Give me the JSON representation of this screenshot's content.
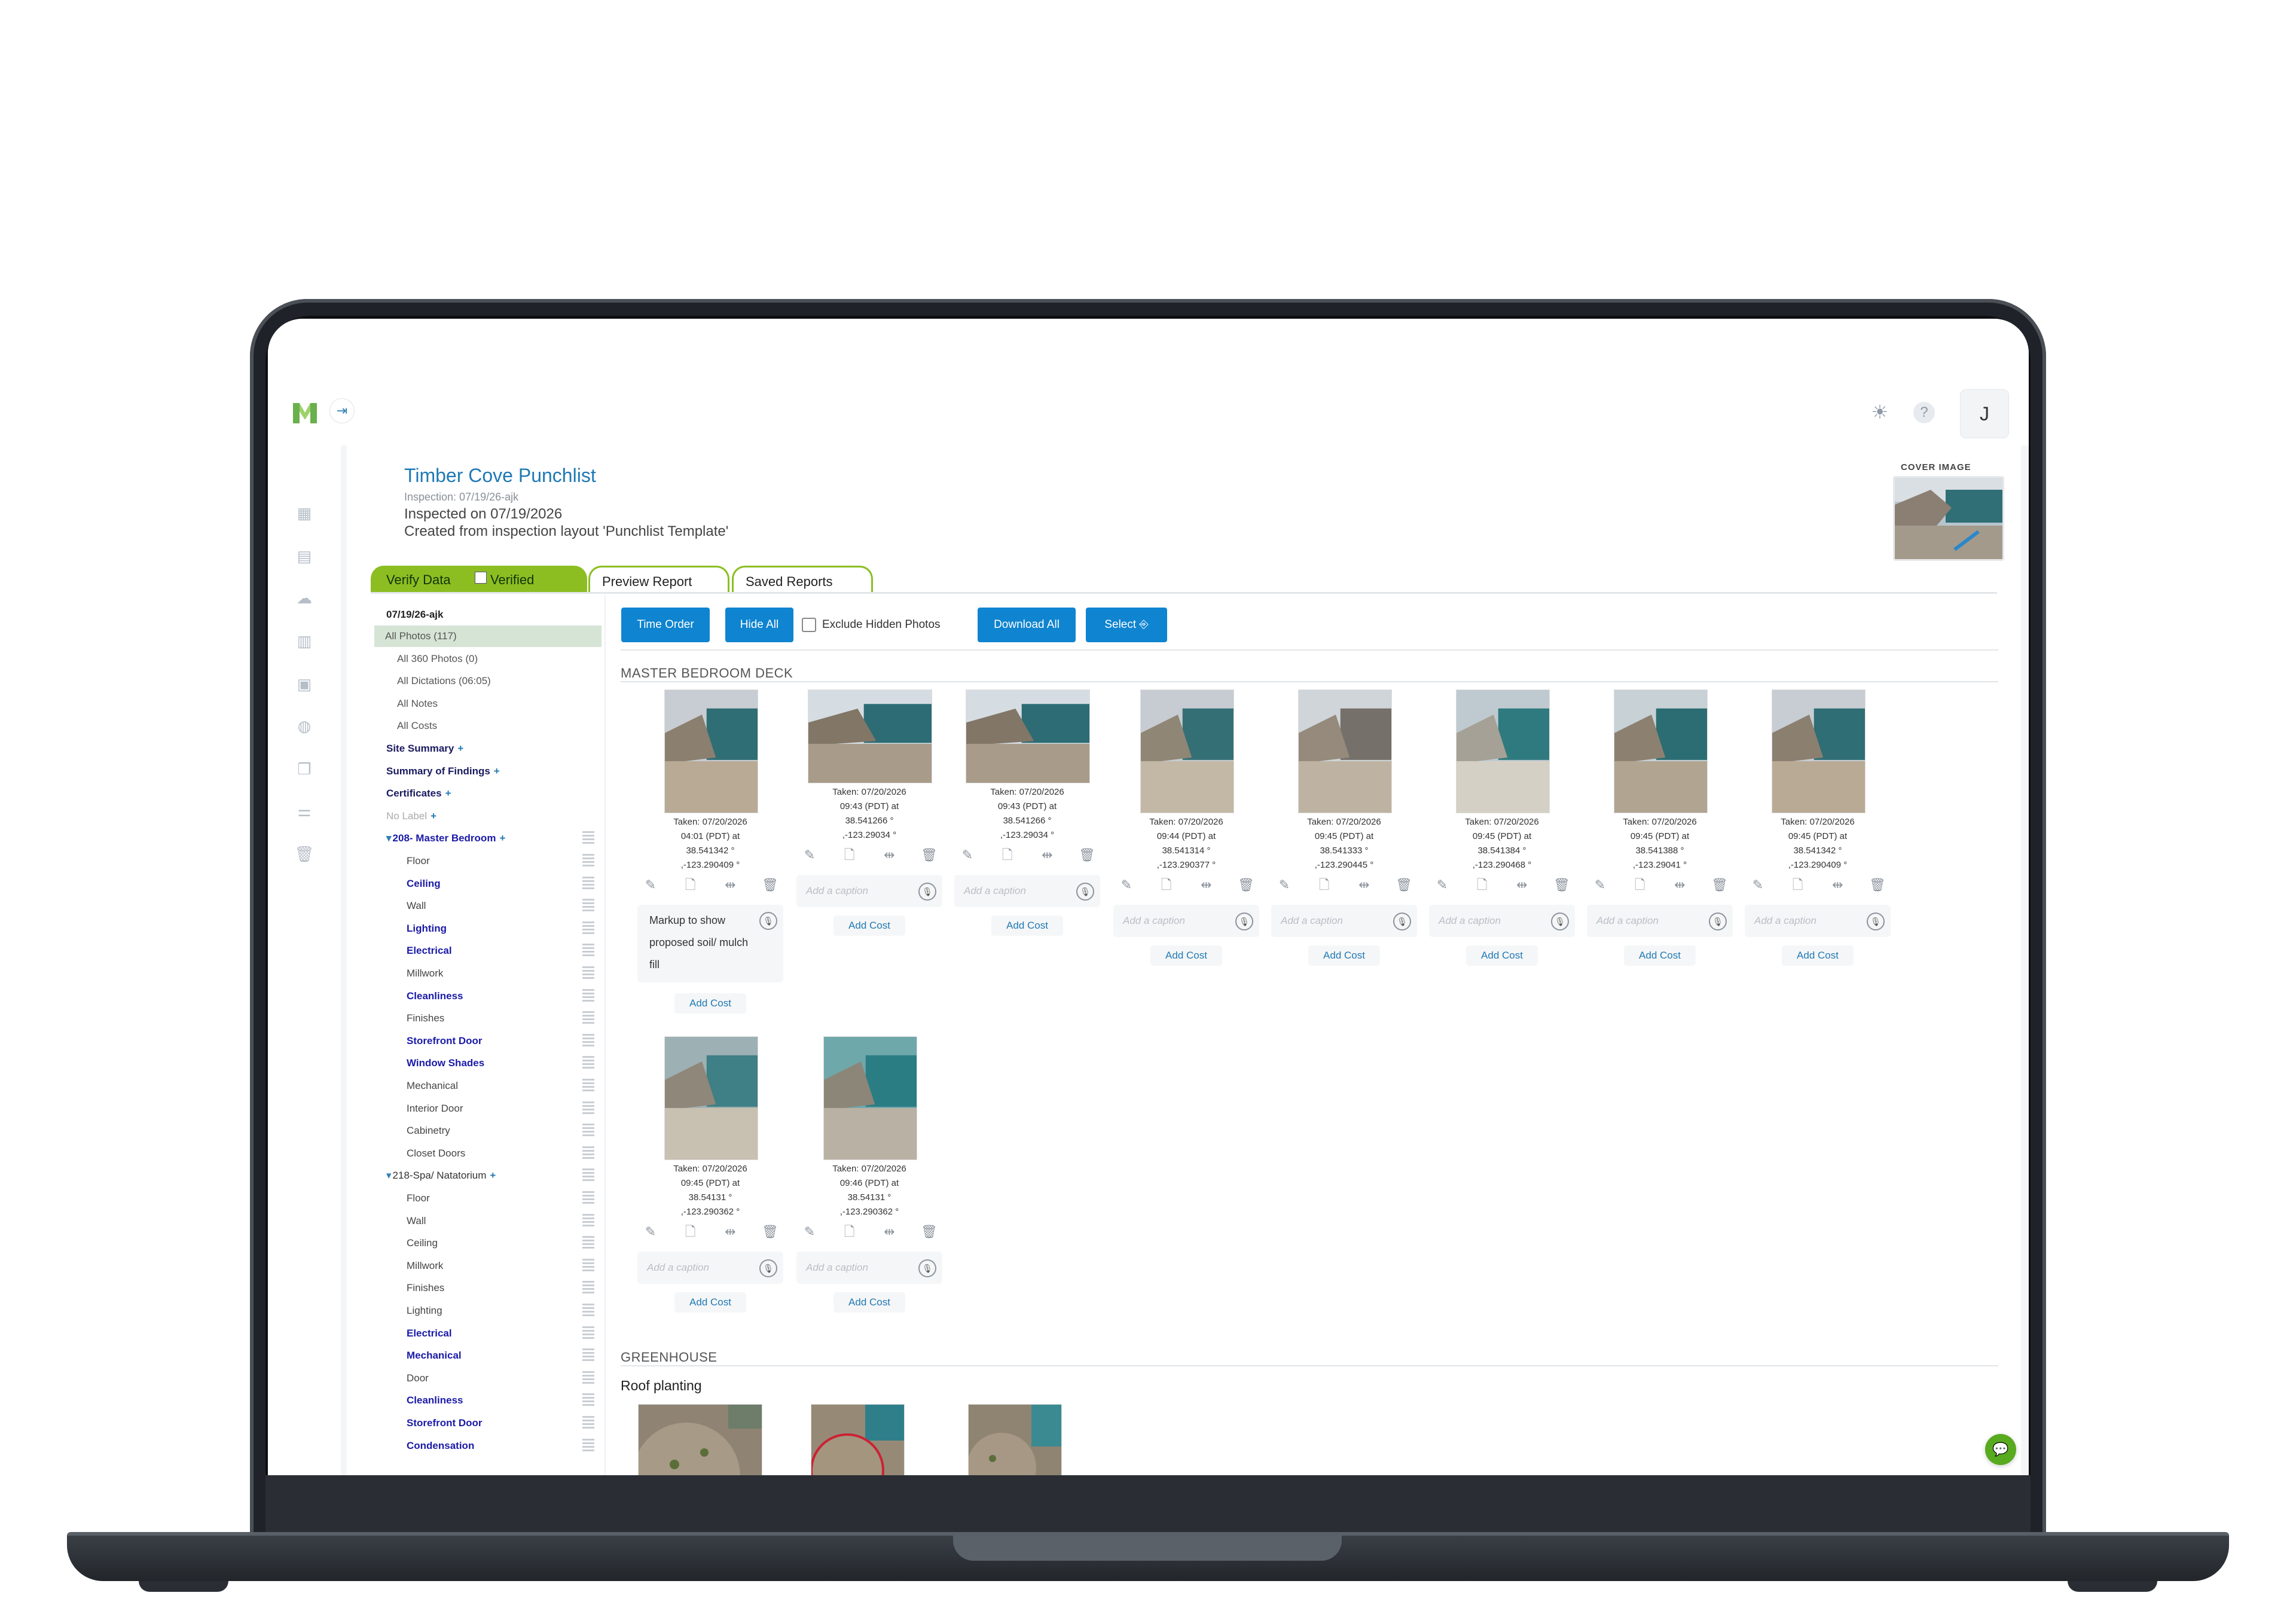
{
  "header": {
    "collapse_icon": "collapse-arrow-icon",
    "theme_icon": "sun-icon",
    "help_label": "?",
    "avatar_initial": "J"
  },
  "rail": {
    "icons": [
      "dashboard-icon",
      "reports-icon",
      "cloud-icon",
      "layout-icon",
      "calendar-icon",
      "database-icon",
      "files-icon",
      "sliders-icon",
      "trash-icon"
    ]
  },
  "inspection": {
    "title": "Timber Cove Punchlist",
    "id_line": "Inspection: 07/19/26-ajk",
    "date_line": "Inspected on 07/19/2026",
    "layout_line": "Created from inspection layout 'Punchlist Template'",
    "cover_label": "COVER IMAGE"
  },
  "tabs": {
    "verify": "Verify Data",
    "verified": "Verified",
    "preview": "Preview Report",
    "saved": "Saved Reports"
  },
  "sidebar": {
    "date": "07/19/26-ajk",
    "items": [
      {
        "label": "All Photos (117)",
        "style": "active"
      },
      {
        "label": "All 360 Photos (0)",
        "style": "sub"
      },
      {
        "label": "All Dictations (06:05)",
        "style": "sub"
      },
      {
        "label": "All Notes",
        "style": "sub"
      },
      {
        "label": "All Costs",
        "style": "sub"
      },
      {
        "label": "Site Summary",
        "plus": "+",
        "style": "head"
      },
      {
        "label": "Summary of Findings",
        "plus": "+",
        "style": "head"
      },
      {
        "label": "Certificates",
        "plus": "+",
        "style": "head"
      },
      {
        "label": "No Label",
        "plus": "+",
        "style": "muted"
      },
      {
        "label": "208- Master Bedroom",
        "plus": "+",
        "style": "group"
      },
      {
        "label": "Floor",
        "style": "room"
      },
      {
        "label": "Ceiling",
        "style": "roomb"
      },
      {
        "label": "Wall",
        "style": "room"
      },
      {
        "label": "Lighting",
        "style": "roomb"
      },
      {
        "label": "Electrical",
        "style": "roomb"
      },
      {
        "label": "Millwork",
        "style": "room"
      },
      {
        "label": "Cleanliness",
        "style": "roomb"
      },
      {
        "label": "Finishes",
        "style": "room"
      },
      {
        "label": "Storefront Door",
        "style": "roomb"
      },
      {
        "label": "Window Shades",
        "style": "roomb"
      },
      {
        "label": "Mechanical",
        "style": "room"
      },
      {
        "label": "Interior Door",
        "style": "room"
      },
      {
        "label": "Cabinetry",
        "style": "room"
      },
      {
        "label": "Closet Doors",
        "style": "room"
      },
      {
        "label": "218-Spa/ Natatorium",
        "plus": "+",
        "style": "group2"
      },
      {
        "label": "Floor",
        "style": "room"
      },
      {
        "label": "Wall",
        "style": "room"
      },
      {
        "label": "Ceiling",
        "style": "room"
      },
      {
        "label": "Millwork",
        "style": "room"
      },
      {
        "label": "Finishes",
        "style": "room"
      },
      {
        "label": "Lighting",
        "style": "room"
      },
      {
        "label": "Electrical",
        "style": "roomb"
      },
      {
        "label": "Mechanical",
        "style": "roomb"
      },
      {
        "label": "Door",
        "style": "room"
      },
      {
        "label": "Cleanliness",
        "style": "roomb"
      },
      {
        "label": "Storefront Door",
        "style": "roomb"
      },
      {
        "label": "Condensation",
        "style": "roomb"
      }
    ]
  },
  "toolbar": {
    "time_order": "Time Order",
    "hide_all": "Hide All",
    "exclude_hidden": "Exclude Hidden Photos",
    "download_all": "Download All",
    "select": "Select"
  },
  "sections": {
    "master_deck": "MASTER BEDROOM DECK",
    "greenhouse": "GREENHOUSE",
    "roof_planting": "Roof planting"
  },
  "caption_placeholder": "Add a caption",
  "add_cost_label": "Add Cost",
  "photos": [
    {
      "taken": "Taken: 07/20/2026",
      "time": "04:01 (PDT) at",
      "lat": "38.541342 °",
      "lon": ",-123.290409 °",
      "caption": "Markup to show proposed soil/ mulch fill",
      "palette": "deck"
    },
    {
      "taken": "Taken: 07/20/2026",
      "time": "09:43 (PDT) at",
      "lat": "38.541266 °",
      "lon": ",-123.29034 °",
      "caption": "",
      "palette": "wide"
    },
    {
      "taken": "Taken: 07/20/2026",
      "time": "09:43 (PDT) at",
      "lat": "38.541266 °",
      "lon": ",-123.29034 °",
      "caption": "",
      "palette": "wide"
    },
    {
      "taken": "Taken: 07/20/2026",
      "time": "09:44 (PDT) at",
      "lat": "38.541314 °",
      "lon": ",-123.290377 °",
      "caption": "",
      "palette": "stairs"
    },
    {
      "taken": "Taken: 07/20/2026",
      "time": "09:45 (PDT) at",
      "lat": "38.541333 °",
      "lon": ",-123.290445 °",
      "caption": "",
      "palette": "rock"
    },
    {
      "taken": "Taken: 07/20/2026",
      "time": "09:45 (PDT) at",
      "lat": "38.541384 °",
      "lon": ",-123.290468 °",
      "caption": "",
      "palette": "glass"
    },
    {
      "taken": "Taken: 07/20/2026",
      "time": "09:45 (PDT) at",
      "lat": "38.541388 °",
      "lon": ",-123.29041 °",
      "caption": "",
      "palette": "glass2"
    },
    {
      "taken": "Taken: 07/20/2026",
      "time": "09:45 (PDT) at",
      "lat": "38.541342 °",
      "lon": ",-123.290409 °",
      "caption": "",
      "palette": "deck"
    },
    {
      "taken": "Taken: 07/20/2026",
      "time": "09:45 (PDT) at",
      "lat": "38.54131 °",
      "lon": ",-123.290362 °",
      "caption": "",
      "palette": "stairs2"
    },
    {
      "taken": "Taken: 07/20/2026",
      "time": "09:46 (PDT) at",
      "lat": "38.54131 °",
      "lon": ",-123.290362 °",
      "caption": "",
      "palette": "pipe"
    }
  ],
  "colors": {
    "accent_blue": "#0f84d0",
    "title_blue": "#1f79b5",
    "tab_green": "#8cbe22",
    "link_navy": "#1a1aa8"
  }
}
